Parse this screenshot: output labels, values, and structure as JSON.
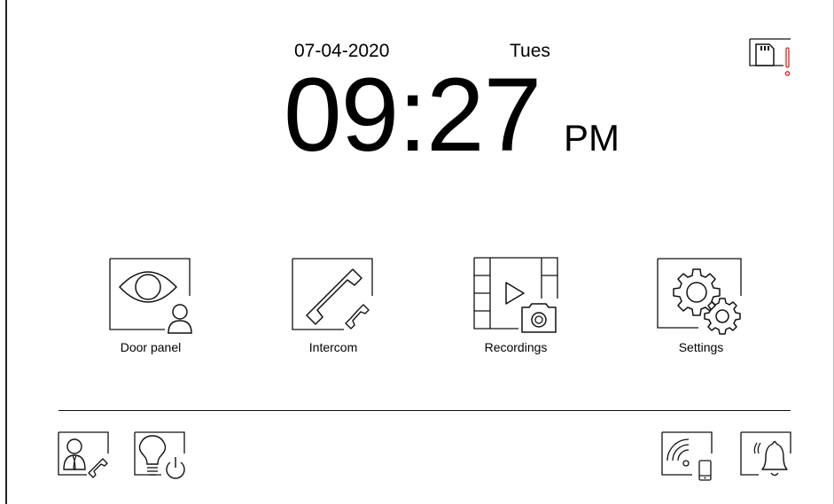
{
  "status": {
    "date": "07-04-2020",
    "day": "Tues",
    "time": "09:27",
    "ampm": "PM",
    "sd_card_alert_icon": "sd-card-warning-icon",
    "alert_color": "#e0201c"
  },
  "apps": [
    {
      "label": "Door panel",
      "icon": "eye-person-icon"
    },
    {
      "label": "Intercom",
      "icon": "handset-icon"
    },
    {
      "label": "Recordings",
      "icon": "film-camera-icon"
    },
    {
      "label": "Settings",
      "icon": "gears-icon"
    }
  ],
  "quick_actions": [
    {
      "icon": "concierge-call-icon"
    },
    {
      "icon": "light-power-icon"
    },
    {
      "icon": "wifi-mobile-icon"
    },
    {
      "icon": "doorbell-icon"
    }
  ]
}
